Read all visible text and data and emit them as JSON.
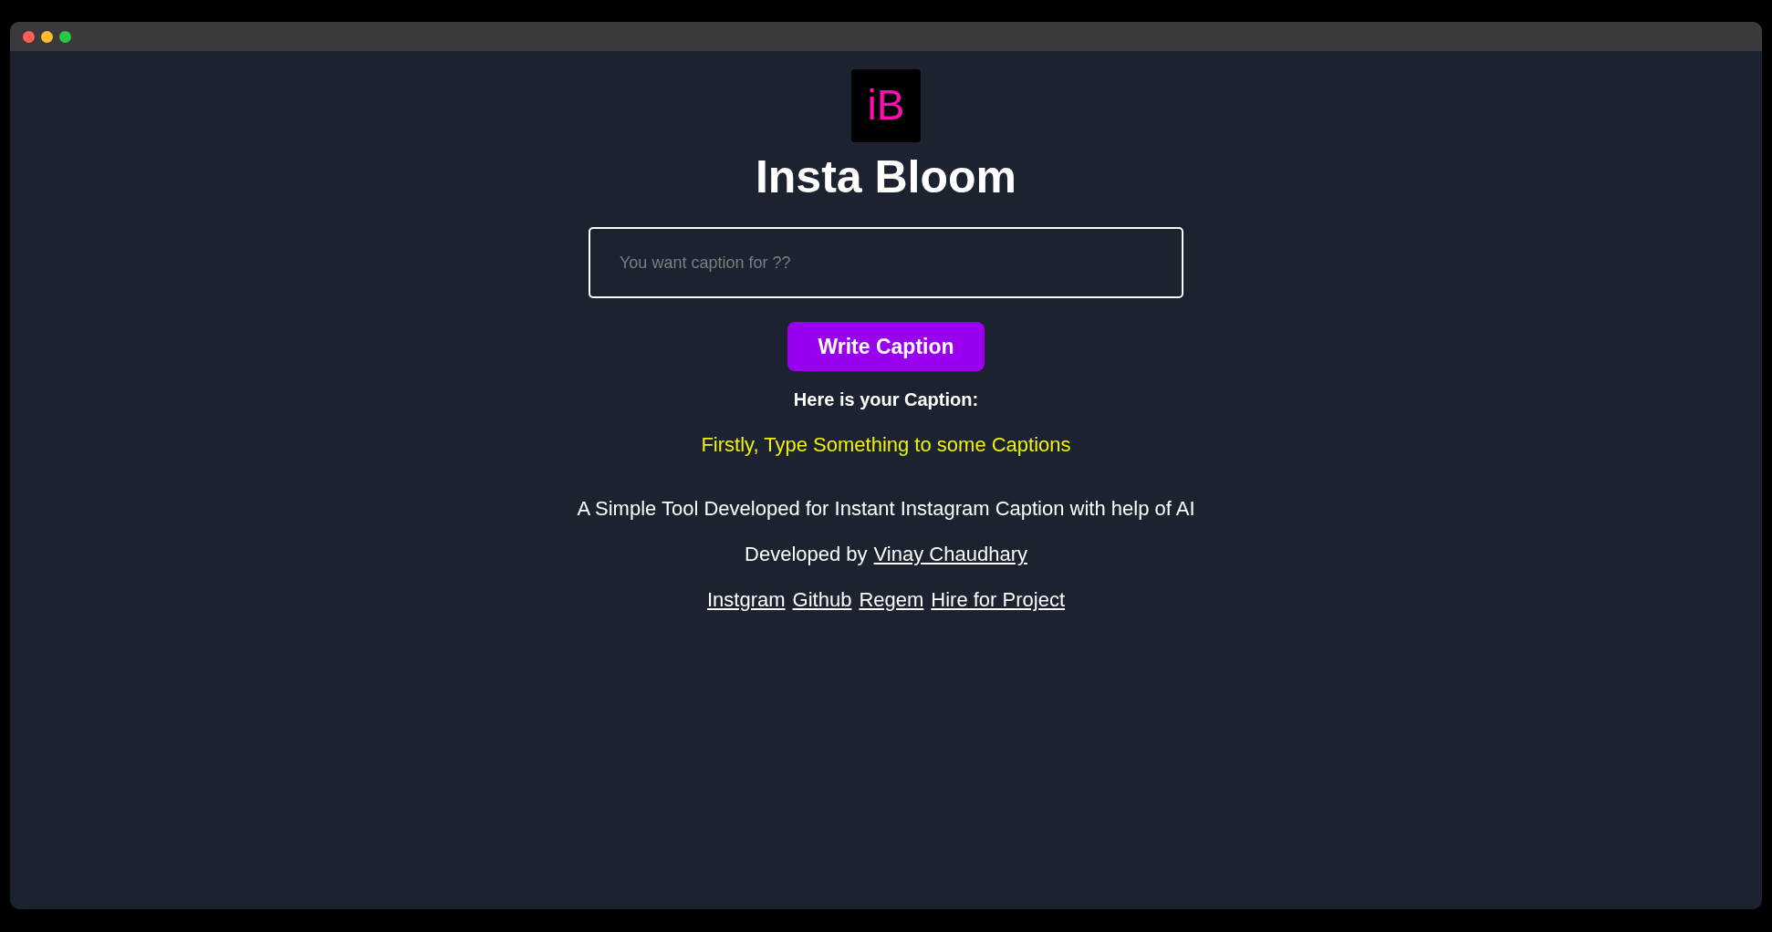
{
  "window": {
    "controls": [
      {
        "color": "#ff5f57"
      },
      {
        "color": "#febc2e"
      },
      {
        "color": "#28c840"
      }
    ]
  },
  "logo": {
    "text": "iB"
  },
  "title": "Insta Bloom",
  "caption_input": {
    "placeholder": "You want caption for ??"
  },
  "write_button": {
    "label": "Write Caption"
  },
  "result": {
    "heading": "Here is your Caption:",
    "text": "Firstly, Type Something to some Captions"
  },
  "description": "A Simple Tool Developed for Instant Instagram Caption with help of AI",
  "credit": {
    "label": "Developed by",
    "link": "Vinay Chaudhary"
  },
  "footer_links": [
    "Instgram",
    "Github",
    "Regem",
    "Hire for Project"
  ]
}
